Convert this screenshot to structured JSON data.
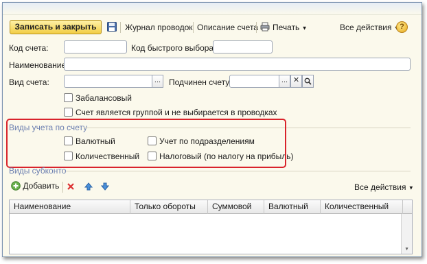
{
  "toolbar": {
    "save_close": "Записать и закрыть",
    "save_icon": "floppy-disk-icon",
    "journal": "Журнал проводок",
    "description": "Описание счета",
    "print": "Печать",
    "all_actions": "Все действия",
    "help": "?"
  },
  "form": {
    "code_label": "Код счета:",
    "code_value": "",
    "quick_code_label": "Код быстрого выбора:",
    "quick_code_value": "",
    "name_label": "Наименование:",
    "name_value": "",
    "type_label": "Вид счета:",
    "type_value": "",
    "type_select": "...",
    "parent_label": "Подчинен счету:",
    "parent_value": "",
    "parent_select": "...",
    "parent_clear": "✕",
    "offbalance": "Забалансовый",
    "is_group": "Счет является группой и не выбирается в проводках"
  },
  "accounting_types": {
    "title": "Виды учета по счету",
    "currency": "Валютный",
    "by_division": "Учет по подразделениям",
    "quantity": "Количественный",
    "tax": "Налоговый (по налогу на прибыль)"
  },
  "subconto": {
    "title": "Виды субконто",
    "add": "Добавить",
    "all_actions": "Все действия",
    "columns": [
      "Наименование",
      "Только обороты",
      "Суммовой",
      "Валютный",
      "Количественный"
    ]
  },
  "colors": {
    "background": "#fbf9ec",
    "accent_button": "#f2cd45",
    "highlight": "#d9232b",
    "group_title": "#6c7fb0"
  }
}
